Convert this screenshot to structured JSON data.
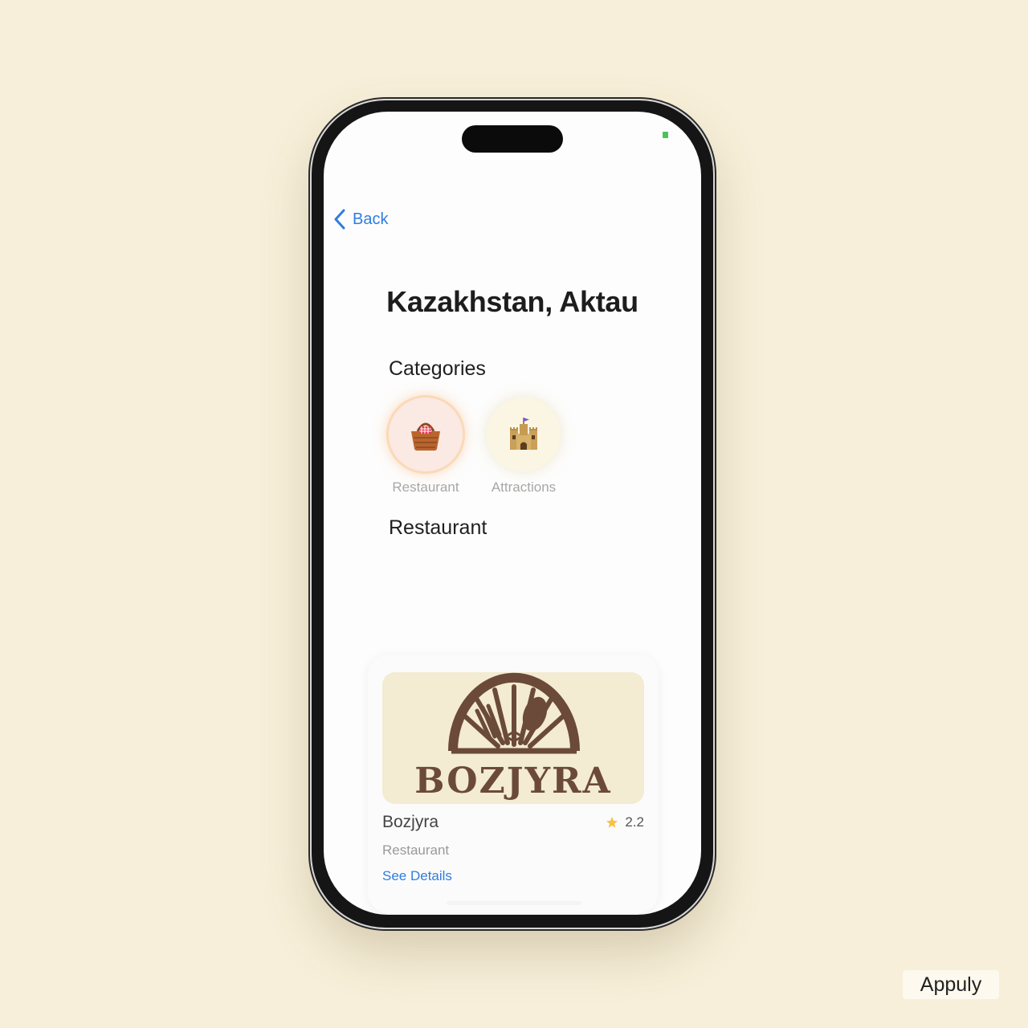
{
  "nav": {
    "back_label": "Back"
  },
  "page": {
    "title": "Kazakhstan, Aktau"
  },
  "categories": {
    "heading": "Categories",
    "items": [
      {
        "label": "Restaurant",
        "icon": "picnic-basket-icon",
        "selected": true
      },
      {
        "label": "Attractions",
        "icon": "castle-icon",
        "selected": false
      }
    ]
  },
  "results": {
    "heading": "Restaurant",
    "items": [
      {
        "logo_text": "BOZJYRA",
        "name": "Bozjyra",
        "rating": "2.2",
        "category": "Restaurant",
        "link": "See Details"
      }
    ]
  },
  "watermark": "Appuly",
  "colors": {
    "accent": "#2f7de1",
    "background": "#f7efd9",
    "star": "#f5c242",
    "logo_brown": "#6b4a3a"
  }
}
